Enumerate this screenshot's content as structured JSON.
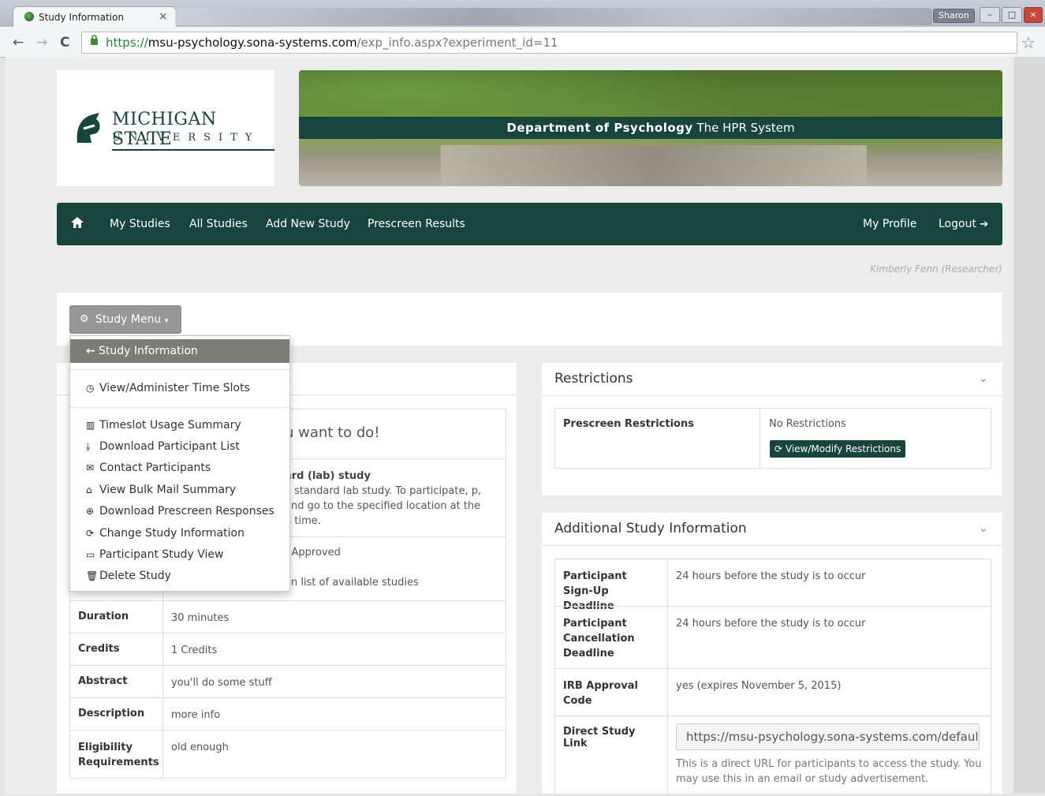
{
  "browser": {
    "tab_title": "Study Information",
    "tab_close": "×",
    "window_user": "Sharon",
    "url_scheme": "https://",
    "url_host": "msu-psychology.sona-systems.com",
    "url_path": "/exp_info.aspx?experiment_id=11"
  },
  "logo": {
    "line1": "MICHIGAN STATE",
    "line2": "UNIVERSITY"
  },
  "banner": {
    "dept": "Department of Psychology",
    "system": "The HPR System"
  },
  "nav": {
    "items": [
      "My Studies",
      "All Studies",
      "Add New Study",
      "Prescreen Results"
    ],
    "my_profile": "My Profile",
    "logout": "Logout"
  },
  "researcher": "Kimberly Fenn (Researcher)",
  "study_menu": {
    "label": "Study Menu",
    "active_item": "Study Information",
    "items": [
      "View/Administer Time Slots",
      "Timeslot Usage Summary",
      "Download Participant List",
      "Contact Participants",
      "View Bulk Mail Summary",
      "Download Prescreen Responses",
      "Change Study Information",
      "Participant Study View",
      "Delete Study"
    ]
  },
  "study": {
    "hero_partial": "u want to do!",
    "type_partial_bold": "ard (lab) study",
    "type_partial_desc": "a standard lab study. To participate, p, and go to the specified location at the n time.",
    "approved_partial": ": Approved",
    "visible_partial": "on list of available studies",
    "rows": [
      {
        "k": "Duration",
        "v": "30 minutes"
      },
      {
        "k": "Credits",
        "v": "1 Credits"
      },
      {
        "k": "Abstract",
        "v": "you'll do some stuff"
      },
      {
        "k": "Description",
        "v": "more info"
      },
      {
        "k": "Eligibility Requirements",
        "v": "old enough"
      }
    ]
  },
  "restrictions": {
    "title": "Restrictions",
    "prescreen_label": "Prescreen Restrictions",
    "prescreen_value": "No Restrictions",
    "button": "View/Modify Restrictions"
  },
  "additional": {
    "title": "Additional Study Information",
    "rows": [
      {
        "k": "Participant Sign-Up Deadline",
        "v": "24 hours before the study is to occur"
      },
      {
        "k": "Participant Cancellation Deadline",
        "v": "24 hours before the study is to occur"
      },
      {
        "k": "IRB Approval Code",
        "v": "yes (expires November 5, 2015)"
      }
    ],
    "direct_link_label": "Direct Study Link",
    "direct_link_value": "https://msu-psychology.sona-systems.com/default.a",
    "direct_link_help": "This is a direct URL for participants to access the study. You may use this in an email or study advertisement."
  },
  "colors": {
    "msu_green": "#18453b",
    "menu_gray": "#979797",
    "dd_active": "#7d7d78"
  }
}
